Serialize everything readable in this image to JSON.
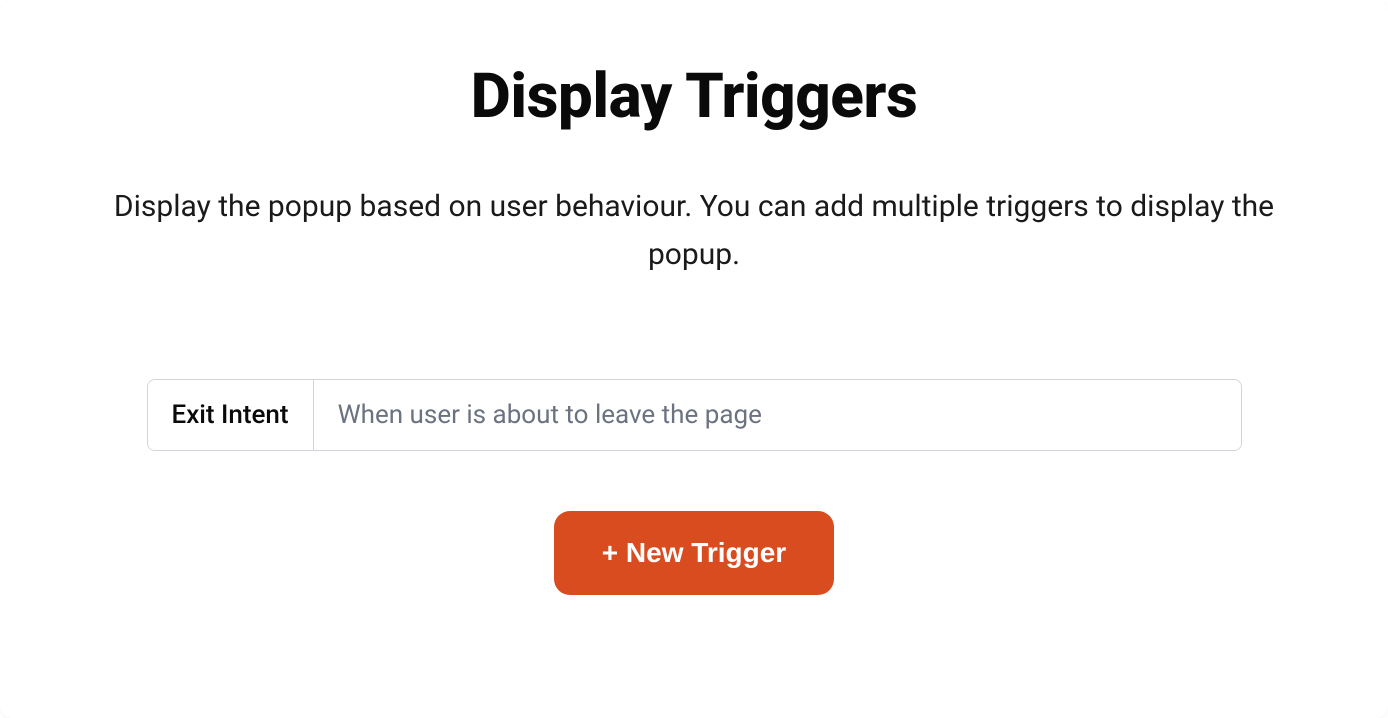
{
  "header": {
    "title": "Display Triggers",
    "description": "Display the popup based on user behaviour. You can add multiple triggers to display the popup."
  },
  "triggers": [
    {
      "label": "Exit Intent",
      "description": "When user is about to leave the page"
    }
  ],
  "actions": {
    "new_trigger_label": "+ New Trigger"
  },
  "colors": {
    "accent": "#d94c20"
  }
}
